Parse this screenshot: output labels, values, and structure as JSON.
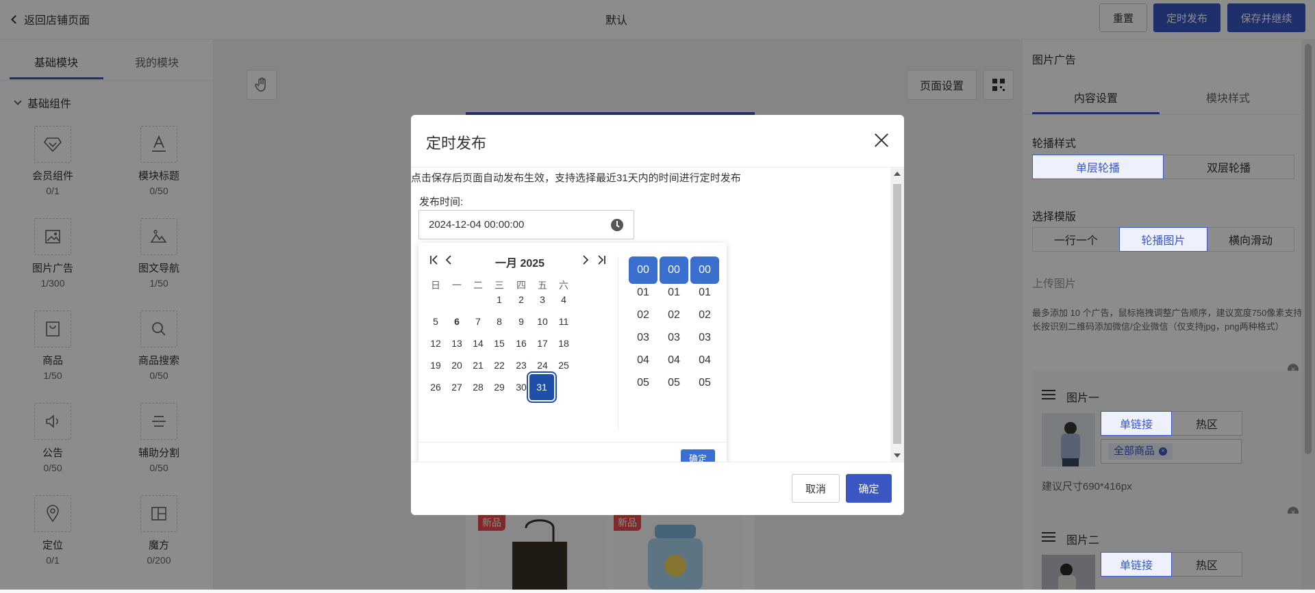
{
  "topbar": {
    "back_label": "返回店铺页面",
    "title": "默认",
    "reset_label": "重置",
    "schedule_label": "定时发布",
    "save_continue_label": "保存并继续"
  },
  "left": {
    "tab_basic": "基础模块",
    "tab_mine": "我的模块",
    "group_title": "基础组件",
    "components": [
      {
        "name": "会员组件",
        "count": "0/1",
        "icon": "diamond-icon"
      },
      {
        "name": "模块标题",
        "count": "0/50",
        "icon": "title-icon"
      },
      {
        "name": "图片广告",
        "count": "1/300",
        "icon": "image-icon"
      },
      {
        "name": "图文导航",
        "count": "1/50",
        "icon": "mountain-icon"
      },
      {
        "name": "商品",
        "count": "1/50",
        "icon": "bag-icon"
      },
      {
        "name": "商品搜索",
        "count": "0/50",
        "icon": "search-icon"
      },
      {
        "name": "公告",
        "count": "0/50",
        "icon": "speaker-icon"
      },
      {
        "name": "辅助分割",
        "count": "0/50",
        "icon": "divider-icon"
      },
      {
        "name": "定位",
        "count": "0/1",
        "icon": "location-icon"
      },
      {
        "name": "魔方",
        "count": "0/200",
        "icon": "grid-icon"
      }
    ]
  },
  "canvas": {
    "page_settings_label": "页面设置",
    "new_tag": "新品"
  },
  "right": {
    "title": "图片广告",
    "tab_content": "内容设置",
    "tab_style": "模块样式",
    "carousel_label": "轮播样式",
    "carousel_options": [
      "单层轮播",
      "双层轮播"
    ],
    "template_label": "选择模版",
    "template_options": [
      "一行一个",
      "轮播图片",
      "横向滑动"
    ],
    "upload_label": "上传图片",
    "hint": "最多添加 10 个广告，鼠标拖拽调整广告顺序，建议宽度750像素支持长按识别二维码添加微信/企业微信（仅支持jpg，png两种格式）",
    "cards": [
      {
        "title": "图片一",
        "link_tab": "单链接",
        "hot_tab": "热区",
        "link_value": "全部商品",
        "size_hint": "建议尺寸690*416px"
      },
      {
        "title": "图片二",
        "link_tab": "单链接",
        "hot_tab": "热区"
      }
    ]
  },
  "dialog": {
    "title": "定时发布",
    "description": "点击保存后页面自动发布生效，支持选择最近31天内的时间进行定时发布",
    "field_label": "发布时间:",
    "value": "2024-12-04 00:00:00",
    "cancel_label": "取消",
    "ok_label": "确定",
    "picker": {
      "month_title": "一月 2025",
      "weekdays": [
        "日",
        "一",
        "二",
        "三",
        "四",
        "五",
        "六"
      ],
      "days": [
        [
          "",
          "",
          "",
          "1",
          "2",
          "3",
          "4"
        ],
        [
          "5",
          "6",
          "7",
          "8",
          "9",
          "10",
          "11"
        ],
        [
          "12",
          "13",
          "14",
          "15",
          "16",
          "17",
          "18"
        ],
        [
          "19",
          "20",
          "21",
          "22",
          "23",
          "24",
          "25"
        ],
        [
          "26",
          "27",
          "28",
          "29",
          "30",
          "31",
          ""
        ]
      ],
      "bold_day": "6",
      "selected_day": "31",
      "hours": [
        "00",
        "01",
        "02",
        "03",
        "04",
        "05"
      ],
      "minutes": [
        "00",
        "01",
        "02",
        "03",
        "04",
        "05"
      ],
      "seconds": [
        "00",
        "01",
        "02",
        "03",
        "04",
        "05"
      ],
      "confirm_label": "确定"
    }
  },
  "colors": {
    "primary": "#3a57c4",
    "selected": "#1f4fa8",
    "time_selected": "#3a6fcf",
    "tag": "#ee4a4a"
  }
}
